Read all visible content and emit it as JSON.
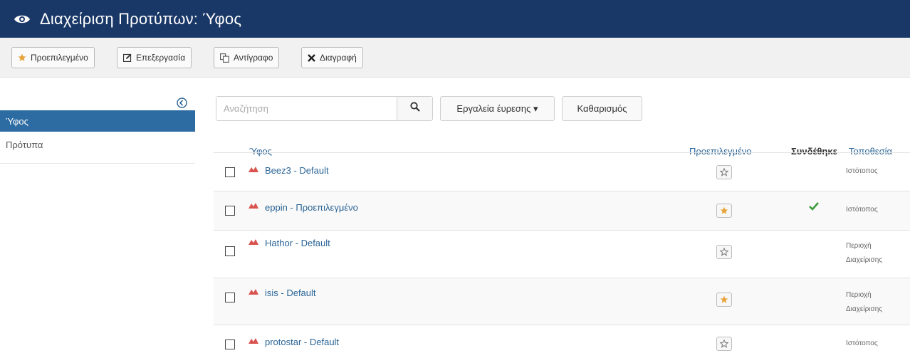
{
  "header": {
    "title": "Διαχείριση Προτύπων: Ύφος",
    "icon": "eye-icon"
  },
  "toolbar": {
    "buttons": [
      {
        "label": "Προεπιλεγμένο",
        "icon": "star-icon"
      },
      {
        "label": "Επεξεργασία",
        "icon": "edit-icon"
      },
      {
        "label": "Αντίγραφο",
        "icon": "copy-icon"
      },
      {
        "label": "Διαγραφή",
        "icon": "close-icon"
      }
    ]
  },
  "sidebar": {
    "items": [
      {
        "label": "Ύφος",
        "active": true
      },
      {
        "label": "Πρότυπα",
        "active": false
      }
    ]
  },
  "search": {
    "placeholder": "Αναζήτηση",
    "tools_label": "Εργαλεία έυρεσης ▾",
    "clear_label": "Καθαρισμός"
  },
  "table": {
    "headers": {
      "style": "Ύφος",
      "default": "Προεπιλεγμένο",
      "assigned": "Συνδέθηκε",
      "location": "Τοποθεσία"
    },
    "rows": [
      {
        "style": "Beez3 - Default",
        "is_default": false,
        "assigned": false,
        "location": [
          "Ιστότοπος"
        ]
      },
      {
        "style": "eppin - Προεπιλεγμένο",
        "is_default": true,
        "assigned": true,
        "location": [
          "Ιστότοπος"
        ]
      },
      {
        "style": "Hathor - Default",
        "is_default": false,
        "assigned": false,
        "location": [
          "Περιοχή",
          "Διαχείρισης"
        ]
      },
      {
        "style": "isis - Default",
        "is_default": true,
        "assigned": false,
        "location": [
          "Περιοχή",
          "Διαχείρισης"
        ]
      },
      {
        "style": "protostar - Default",
        "is_default": false,
        "assigned": false,
        "location": [
          "Ιστότοπος"
        ]
      }
    ]
  },
  "colors": {
    "header_bg": "#1a3867",
    "link": "#2a6496",
    "active_sidebar": "#2d6ca2",
    "star_default": "#e8a338",
    "check_green": "#3c9a3c"
  }
}
